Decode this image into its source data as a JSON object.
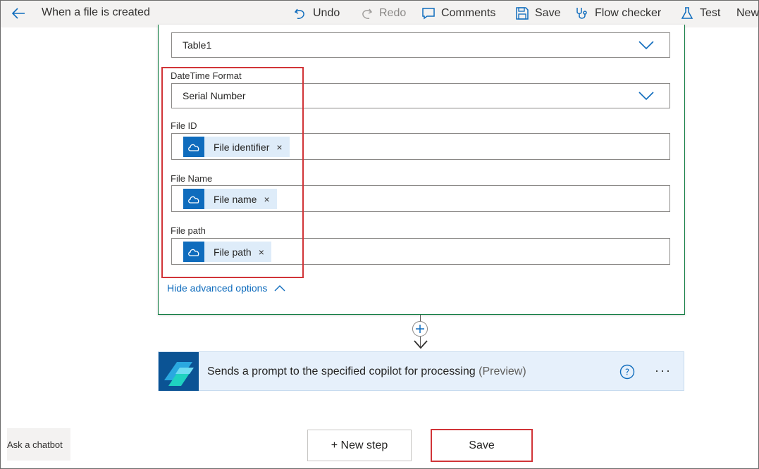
{
  "header": {
    "title": "When a file is created",
    "commands": [
      {
        "label": "Undo",
        "icon": "undo-icon"
      },
      {
        "label": "Redo",
        "icon": "redo-icon"
      },
      {
        "label": "Comments",
        "icon": "comment-icon"
      },
      {
        "label": "Save",
        "icon": "save-icon"
      },
      {
        "label": "Flow checker",
        "icon": "stethoscope-icon"
      },
      {
        "label": "Test",
        "icon": "flask-icon"
      },
      {
        "label": "New",
        "icon": ""
      }
    ]
  },
  "action": {
    "table_value": "Table1",
    "datetime_label": "DateTime Format",
    "datetime_value": "Serial Number",
    "file_id_label": "File ID",
    "file_id_token": "File identifier",
    "file_name_label": "File Name",
    "file_name_token": "File name",
    "file_path_label": "File path",
    "file_path_token": "File path",
    "token_remove": "×",
    "advanced_link": "Hide advanced options"
  },
  "next_step": {
    "title": "Sends a prompt to the specified copilot for processing",
    "tag": "(Preview)",
    "more": "···"
  },
  "footer": {
    "chatbot": "Ask a chatbot",
    "new_step": "+ New step",
    "save": "Save"
  },
  "colors": {
    "accent": "#0f6cbd",
    "highlight": "#d13438",
    "card_border": "#107c41",
    "step_bg": "#e6f0fb"
  }
}
